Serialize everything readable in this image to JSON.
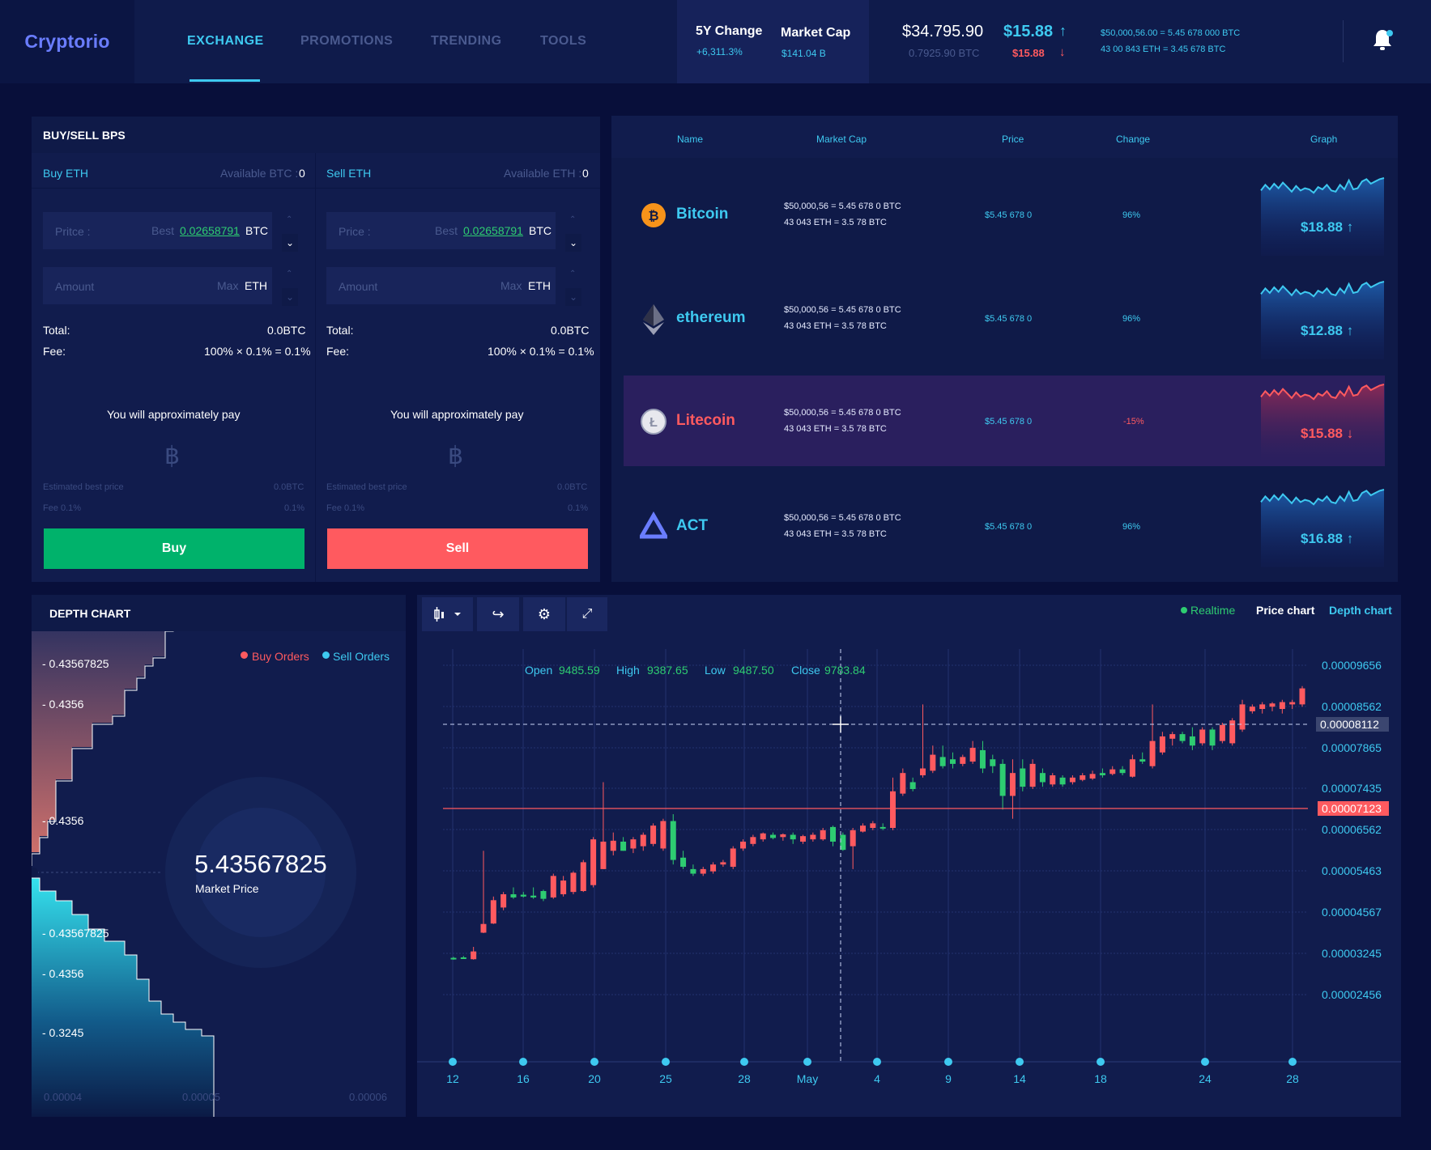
{
  "header": {
    "logo": "Cryptorio",
    "nav": [
      "EXCHANGE",
      "PROMOTIONS",
      "TRENDING",
      "TOOLS"
    ],
    "stats": [
      {
        "title": "5Y Change",
        "value": "+6,311.3%"
      },
      {
        "title": "Market Cap",
        "value": "$141.04 B"
      }
    ],
    "price_usd": "$34.795.90",
    "price_btc": "0.7925.90 BTC",
    "change_up": "$15.88",
    "change_down": "$15.88",
    "info_line1": "$50,000,56.00 = 5.45 678 000 BTC",
    "info_line2": "43 00 843 ETH = 3.45 678 BTC"
  },
  "buysell": {
    "title": "BUY/SELL BPS",
    "buy": {
      "label": "Buy ETH",
      "available": "Available BTC :",
      "available_val": "0",
      "price_placeholder": "Pritce :",
      "best": "Best",
      "best_val": "0.02658791",
      "price_unit": "BTC",
      "amount_placeholder": "Amount",
      "max": "Max",
      "amount_unit": "ETH",
      "total_label": "Total:",
      "total_val": "0.0BTC",
      "fee_label": "Fee:",
      "fee_val": "100% × 0.1% = 0.1%",
      "approx": "You will approximately pay",
      "currency_symbol": "฿",
      "est_label": "Estimated best price",
      "est_val": "0.0BTC",
      "fee_small_label": "Fee 0.1%",
      "fee_small_val": "0.1%",
      "button": "Buy",
      "color": "#00b26b"
    },
    "sell": {
      "label": "Sell ETH",
      "available": "Available ETH :",
      "available_val": "0",
      "price_placeholder": "Price :",
      "best": "Best",
      "best_val": "0.02658791",
      "price_unit": "BTC",
      "amount_placeholder": "Amount",
      "max": "Max",
      "amount_unit": "ETH",
      "total_label": "Total:",
      "total_val": "0.0BTC",
      "fee_label": "Fee:",
      "fee_val": "100% × 0.1% = 0.1%",
      "approx": "You will approximately pay",
      "currency_symbol": "฿",
      "est_label": "Estimated best price",
      "est_val": "0.0BTC",
      "fee_small_label": "Fee 0.1%",
      "fee_small_val": "0.1%",
      "button": "Sell",
      "color": "#ff5a5f"
    }
  },
  "market": {
    "headers": [
      "Name",
      "Market Cap",
      "Price",
      "Change",
      "Graph"
    ],
    "rows": [
      {
        "name": "Bitcoin",
        "icon": "bitcoin-icon",
        "mc1": "$50,000,56 = 5.45 678 0 BTC",
        "mc2": "43 043 ETH = 3.5 78 BTC",
        "price": "$5.45 678 0",
        "change": "96%",
        "graph": "$18.88",
        "arrow": "↑",
        "up": true
      },
      {
        "name": "ethereum",
        "icon": "ethereum-icon",
        "mc1": "$50,000,56 = 5.45 678 0 BTC",
        "mc2": "43 043 ETH = 3.5 78 BTC",
        "price": "$5.45 678 0",
        "change": "96%",
        "graph": "$12.88",
        "arrow": "↑",
        "up": true
      },
      {
        "name": "Litecoin",
        "icon": "litecoin-icon",
        "mc1": "$50,000,56 = 5.45 678 0 BTC",
        "mc2": "43 043 ETH = 3.5 78 BTC",
        "price": "$5.45 678 0",
        "change": "-15%",
        "graph": "$15.88",
        "arrow": "↓",
        "up": false
      },
      {
        "name": "ACT",
        "icon": "act-icon",
        "mc1": "$50,000,56 = 5.45 678 0 BTC",
        "mc2": "43 043 ETH = 3.5 78 BTC",
        "price": "$5.45 678 0",
        "change": "96%",
        "graph": "$16.88",
        "arrow": "↑",
        "up": true
      }
    ]
  },
  "depth": {
    "title": "DEPTH CHART",
    "legend_buy": "Buy Orders",
    "legend_sell": "Sell Orders",
    "market_price": "5.43567825",
    "market_price_label": "Market Price",
    "ylabels": [
      "- 0.43567825",
      "- 0.4356",
      "- 0.4356",
      "- 0.43567825",
      "- 0.4356",
      "- 0.3245"
    ],
    "xlabels": [
      "0.00004",
      "0.00005",
      "0.00006"
    ]
  },
  "price_chart": {
    "tabs": {
      "realtime": "Realtime",
      "price": "Price chart",
      "depth": "Depth chart"
    },
    "ohlc": {
      "open_label": "Open",
      "open": "9485.59",
      "high_label": "High",
      "high": "9387.65",
      "low_label": "Low",
      "low": "9487.50",
      "close_label": "Close",
      "close": "9783.84"
    },
    "yticks": [
      "0.00009656",
      "0.00008562",
      "0.00007865",
      "0.00007435",
      "0.00006562",
      "0.00005463",
      "0.00004567",
      "0.00003245",
      "0.00002456"
    ],
    "crosshair_label": "0.00008112",
    "current_label": "0.00007123",
    "xticks": [
      "12",
      "16",
      "20",
      "25",
      "28",
      "May",
      "4",
      "9",
      "14",
      "18",
      "24",
      "28"
    ],
    "colors": {
      "up": "#ff5a5f",
      "down": "#2ecc71"
    }
  },
  "chart_data": {
    "type": "candlestick",
    "ylim": [
      1.8e-05,
      0.0001
    ],
    "candles": [
      [
        3.22e-05,
        3.28e-05,
        3.26e-05,
        3.24e-05
      ],
      [
        3.24e-05,
        3.3e-05,
        3.27e-05,
        3.25e-05
      ],
      [
        3.22e-05,
        3.5e-05,
        3.23e-05,
        3.4e-05
      ],
      [
        3.8e-05,
        5.6e-05,
        3.81e-05,
        4e-05
      ],
      [
        4e-05,
        4.6e-05,
        4.01e-05,
        4.52e-05
      ],
      [
        4.3e-05,
        4.7e-05,
        4.36e-05,
        4.65e-05
      ],
      [
        4.55e-05,
        4.8e-05,
        4.65e-05,
        4.58e-05
      ],
      [
        4.58e-05,
        4.7e-05,
        4.64e-05,
        4.6e-05
      ],
      [
        4.55e-05,
        4.8e-05,
        4.62e-05,
        4.58e-05
      ],
      [
        4.5e-05,
        4.75e-05,
        4.72e-05,
        4.55e-05
      ],
      [
        4.55e-05,
        5.1e-05,
        4.58e-05,
        5.05e-05
      ],
      [
        4.6e-05,
        5.05e-05,
        4.65e-05,
        4.95e-05
      ],
      [
        4.65e-05,
        5.15e-05,
        4.7e-05,
        5.12e-05
      ],
      [
        4.7e-05,
        5.4e-05,
        4.72e-05,
        5.35e-05
      ],
      [
        4.8e-05,
        5.9e-05,
        4.85e-05,
        5.85e-05
      ],
      [
        5.2e-05,
        7.1e-05,
        5.2e-05,
        5.8e-05
      ],
      [
        5.5e-05,
        6e-05,
        5.6e-05,
        5.82e-05
      ],
      [
        5.6e-05,
        5.9e-05,
        5.8e-05,
        5.6e-05
      ],
      [
        5.55e-05,
        5.9e-05,
        5.65e-05,
        5.85e-05
      ],
      [
        5.6e-05,
        6e-05,
        5.7e-05,
        5.95e-05
      ],
      [
        5.7e-05,
        6.2e-05,
        5.75e-05,
        6.15e-05
      ],
      [
        5.6e-05,
        6.3e-05,
        5.65e-05,
        6.25e-05
      ],
      [
        5.3e-05,
        6.4e-05,
        6.25e-05,
        5.4e-05
      ],
      [
        5.2e-05,
        5.6e-05,
        5.45e-05,
        5.25e-05
      ],
      [
        5.05e-05,
        5.3e-05,
        5.2e-05,
        5.1e-05
      ],
      [
        5.05e-05,
        5.25e-05,
        5.1e-05,
        5.2e-05
      ],
      [
        5.1e-05,
        5.35e-05,
        5.15e-05,
        5.3e-05
      ],
      [
        5.25e-05,
        5.4e-05,
        5.3e-05,
        5.35e-05
      ],
      [
        5.2e-05,
        5.7e-05,
        5.25e-05,
        5.65e-05
      ],
      [
        5.6e-05,
        5.85e-05,
        5.65e-05,
        5.8e-05
      ],
      [
        5.7e-05,
        5.95e-05,
        5.75e-05,
        5.9e-05
      ],
      [
        5.8e-05,
        6e-05,
        5.85e-05,
        5.98e-05
      ],
      [
        5.85e-05,
        6e-05,
        5.95e-05,
        5.88e-05
      ],
      [
        5.82e-05,
        5.98e-05,
        5.9e-05,
        5.96e-05
      ],
      [
        5.75e-05,
        6e-05,
        5.95e-05,
        5.85e-05
      ],
      [
        5.75e-05,
        5.95e-05,
        5.8e-05,
        5.92e-05
      ],
      [
        5.8e-05,
        6e-05,
        5.85e-05,
        5.95e-05
      ],
      [
        5.82e-05,
        6.1e-05,
        5.85e-05,
        6.05e-05
      ],
      [
        5.7e-05,
        6.15e-05,
        6.12e-05,
        5.8e-05
      ],
      [
        5.6e-05,
        6e-05,
        5.95e-05,
        5.62e-05
      ],
      [
        5.2e-05,
        6.1e-05,
        5.7e-05,
        6.05e-05
      ],
      [
        6e-05,
        6.2e-05,
        6.02e-05,
        6.15e-05
      ],
      [
        6.05e-05,
        6.25e-05,
        6.1e-05,
        6.2e-05
      ],
      [
        6.05e-05,
        6.2e-05,
        6.12e-05,
        6.1e-05
      ],
      [
        6.05e-05,
        7.2e-05,
        6.1e-05,
        6.9e-05
      ],
      [
        6.8e-05,
        7.4e-05,
        6.85e-05,
        7.3e-05
      ],
      [
        6.9e-05,
        7.2e-05,
        7.1e-05,
        6.95e-05
      ],
      [
        7.2e-05,
        8.8e-05,
        7.25e-05,
        7.4e-05
      ],
      [
        7.3e-05,
        7.9e-05,
        7.35e-05,
        7.7e-05
      ],
      [
        7.4e-05,
        7.9e-05,
        7.65e-05,
        7.45e-05
      ],
      [
        7.4e-05,
        7.75e-05,
        7.6e-05,
        7.5e-05
      ],
      [
        7.45e-05,
        7.7e-05,
        7.5e-05,
        7.65e-05
      ],
      [
        7.5e-05,
        8e-05,
        7.55e-05,
        7.85e-05
      ],
      [
        7.3e-05,
        8e-05,
        7.8e-05,
        7.4e-05
      ],
      [
        7.3e-05,
        7.7e-05,
        7.6e-05,
        7.45e-05
      ],
      [
        6.5e-05,
        7.6e-05,
        7.5e-05,
        6.8e-05
      ],
      [
        6.3e-05,
        7.6e-05,
        6.8e-05,
        7.3e-05
      ],
      [
        6.9e-05,
        7.6e-05,
        7.4e-05,
        7e-05
      ],
      [
        6.95e-05,
        7.6e-05,
        7e-05,
        7.5e-05
      ],
      [
        7e-05,
        7.4e-05,
        7.3e-05,
        7.1e-05
      ],
      [
        7e-05,
        7.3e-05,
        7.05e-05,
        7.25e-05
      ],
      [
        7e-05,
        7.25e-05,
        7.2e-05,
        7.05e-05
      ],
      [
        7.05e-05,
        7.25e-05,
        7.1e-05,
        7.2e-05
      ],
      [
        7.12e-05,
        7.3e-05,
        7.15e-05,
        7.25e-05
      ],
      [
        7.15e-05,
        7.35e-05,
        7.18e-05,
        7.28e-05
      ],
      [
        7.2e-05,
        7.4e-05,
        7.3e-05,
        7.25e-05
      ],
      [
        7.25e-05,
        7.45e-05,
        7.28e-05,
        7.38e-05
      ],
      [
        7.25e-05,
        7.45e-05,
        7.38e-05,
        7.3e-05
      ],
      [
        7.2e-05,
        7.7e-05,
        7.22e-05,
        7.6e-05
      ],
      [
        7.5e-05,
        7.75e-05,
        7.6e-05,
        7.55e-05
      ],
      [
        7.4e-05,
        8.8e-05,
        7.45e-05,
        8e-05
      ],
      [
        7.7e-05,
        8.2e-05,
        7.75e-05,
        8.1e-05
      ],
      [
        7.9e-05,
        8.2e-05,
        8.05e-05,
        8.15e-05
      ],
      [
        7.95e-05,
        8.2e-05,
        8.15e-05,
        8e-05
      ],
      [
        7.8e-05,
        8.3e-05,
        8.1e-05,
        7.9e-05
      ],
      [
        7.9e-05,
        8.3e-05,
        7.95e-05,
        8.25e-05
      ],
      [
        7.8e-05,
        8.3e-05,
        8.25e-05,
        7.9e-05
      ],
      [
        7.95e-05,
        8.4e-05,
        8e-05,
        8.35e-05
      ],
      [
        7.9e-05,
        8.5e-05,
        7.95e-05,
        8.45e-05
      ],
      [
        8.2e-05,
        8.9e-05,
        8.25e-05,
        8.8e-05
      ],
      [
        8.6e-05,
        8.8e-05,
        8.65e-05,
        8.75e-05
      ],
      [
        8.6e-05,
        8.85e-05,
        8.7e-05,
        8.8e-05
      ],
      [
        8.65e-05,
        8.85e-05,
        8.75e-05,
        8.82e-05
      ],
      [
        8.6e-05,
        8.9e-05,
        8.7e-05,
        8.85e-05
      ],
      [
        8.7e-05,
        8.9e-05,
        8.8e-05,
        8.85e-05
      ],
      [
        8.75e-05,
        9.2e-05,
        8.8e-05,
        9.15e-05
      ]
    ]
  }
}
